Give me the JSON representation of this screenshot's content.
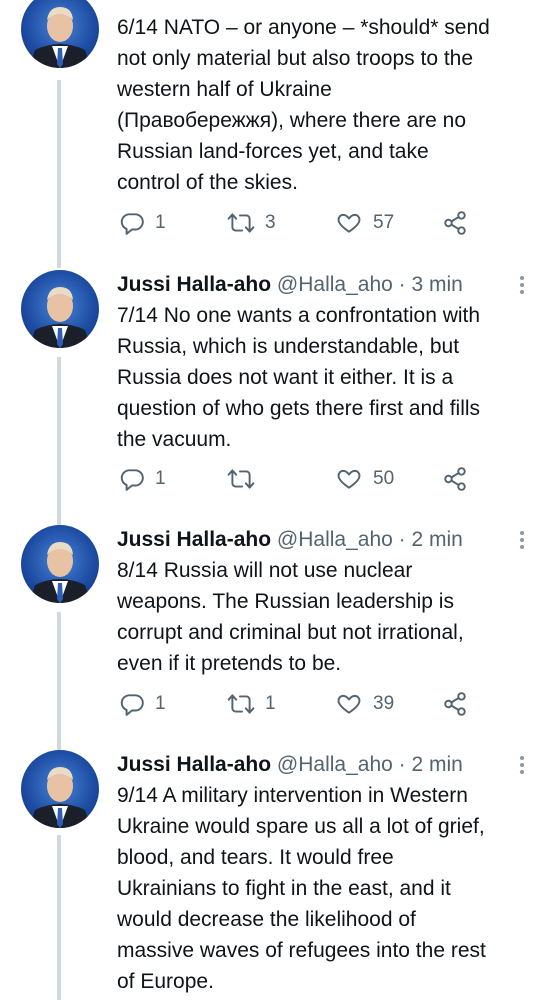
{
  "tweets": [
    {
      "author": "",
      "handle": "",
      "time": "",
      "text": "6/14 NATO – or anyone – *should* send\nnot only material but also troops to the\nwestern half of Ukraine\n(Правобережжя), where there are no\nRussian land-forces yet, and take\ncontrol of the skies.",
      "replies": "1",
      "retweets": "3",
      "likes": "57"
    },
    {
      "author": "Jussi Halla-aho",
      "handle": "@Halla_aho",
      "time": "3 min",
      "text": "7/14 No one wants a confrontation with\nRussia, which is understandable, but\nRussia does not want it either. It is a\nquestion of who gets there first and fills\nthe vacuum.",
      "replies": "1",
      "retweets": "",
      "likes": "50"
    },
    {
      "author": "Jussi Halla-aho",
      "handle": "@Halla_aho",
      "time": "2 min",
      "text": "8/14 Russia will not use nuclear\nweapons. The Russian leadership is\ncorrupt and criminal but not irrational,\neven if it pretends to be.",
      "replies": "1",
      "retweets": "1",
      "likes": "39"
    },
    {
      "author": "Jussi Halla-aho",
      "handle": "@Halla_aho",
      "time": "2 min",
      "text": "9/14 A military intervention in Western\nUkraine would spare us all a lot of grief,\nblood, and tears. It would free\nUkrainians to fight in the east, and it\nwould decrease the likelihood of\nmassive waves of refugees into the rest\nof Europe.",
      "replies": "",
      "retweets": "",
      "likes": ""
    }
  ],
  "separator": "·",
  "icons": {
    "reply": "reply-icon",
    "retweet": "retweet-icon",
    "like": "heart-icon",
    "share": "share-icon",
    "more": "more-icon"
  },
  "colors": {
    "text": "#0f1419",
    "secondary": "#536471",
    "thread_line": "#cfd9de"
  }
}
